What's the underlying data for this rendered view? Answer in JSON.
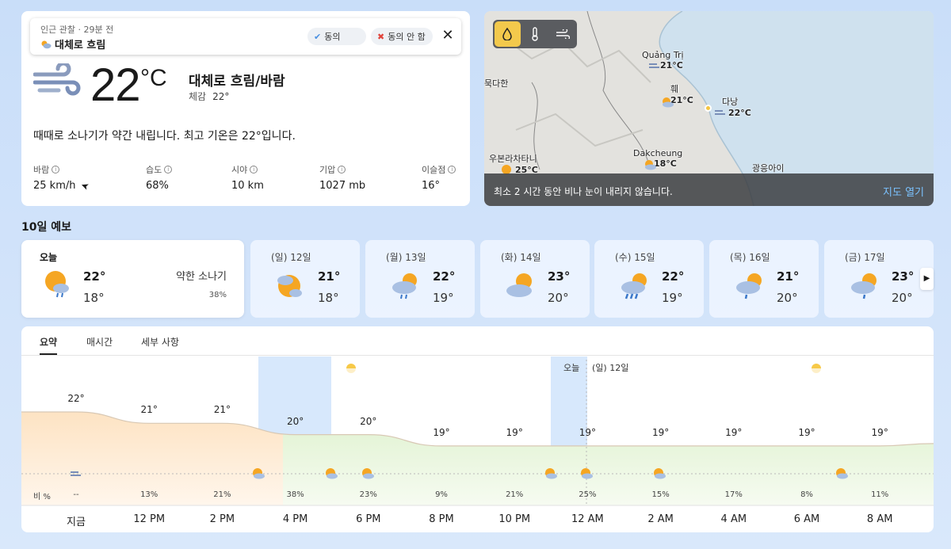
{
  "current": {
    "observation": {
      "header": "인근 관찰 · 29분 전",
      "condition": "대체로 흐림",
      "agree_label": "동의",
      "disagree_label": "동의 안 함"
    },
    "temperature": "22",
    "unit": "°C",
    "condition_title": "대체로 흐림/바람",
    "feels_label": "체감",
    "feels_value": "22°",
    "summary": "때때로 소나기가 약간 내립니다. 최고 기온은 22°입니다.",
    "stats": [
      {
        "label": "바람",
        "value": "25 km/h"
      },
      {
        "label": "습도",
        "value": "68%"
      },
      {
        "label": "시야",
        "value": "10 km"
      },
      {
        "label": "기압",
        "value": "1027 mb"
      },
      {
        "label": "이슬점",
        "value": "16°"
      }
    ]
  },
  "map": {
    "message": "최소 2 시간 동안 비나 눈이 내리지 않습니다.",
    "open_label": "지도 열기",
    "layers": [
      "precipitation-icon",
      "thermometer-icon",
      "wind-icon"
    ],
    "labels": [
      {
        "name": "Quảng Trị",
        "temp": "21°C"
      },
      {
        "name": "훼",
        "temp": "21°C"
      },
      {
        "name": "다낭",
        "temp": "22°C"
      },
      {
        "name": "Dakcheung",
        "temp": "18°C"
      },
      {
        "name": "우본라차타니",
        "temp": "25°C"
      },
      {
        "name": "묵다한",
        "temp": ""
      },
      {
        "name": "광응아이",
        "temp": ""
      }
    ]
  },
  "forecast": {
    "title": "10일 예보",
    "days": [
      {
        "name": "오늘",
        "hi": "22°",
        "lo": "18°",
        "desc": "약한 소나기",
        "precip": "38%",
        "icon": "sun-cloud-rain-icon"
      },
      {
        "name": "(일) 12일",
        "hi": "21°",
        "lo": "18°",
        "icon": "sun-cloud-icon"
      },
      {
        "name": "(월) 13일",
        "hi": "22°",
        "lo": "19°",
        "icon": "sun-cloud-rain-icon"
      },
      {
        "name": "(화) 14일",
        "hi": "23°",
        "lo": "20°",
        "icon": "partly-cloudy-icon"
      },
      {
        "name": "(수) 15일",
        "hi": "22°",
        "lo": "19°",
        "icon": "sun-cloud-heavy-rain-icon"
      },
      {
        "name": "(목) 16일",
        "hi": "21°",
        "lo": "20°",
        "icon": "sun-cloud-rain-icon"
      },
      {
        "name": "(금) 17일",
        "hi": "23°",
        "lo": "20°",
        "icon": "sun-cloud-rain-icon"
      }
    ]
  },
  "chart": {
    "tabs": [
      "요약",
      "매시간",
      "세부 사항"
    ],
    "precip_label": "비 %",
    "today_marker": "오늘",
    "next_day_marker": "(일) 12일"
  },
  "chart_data": {
    "type": "area",
    "x": [
      "지금",
      "",
      "12 PM",
      "",
      "2 PM",
      "",
      "4 PM",
      "",
      "6 PM",
      "",
      "8 PM",
      "",
      "10 PM",
      "",
      "12 AM",
      "",
      "2 AM",
      "",
      "4 AM",
      "",
      "6 AM",
      "",
      "8 AM"
    ],
    "temperature": [
      22,
      21,
      21,
      20,
      20,
      19,
      19,
      19,
      19,
      19,
      19,
      19
    ],
    "temperature_labels": [
      "22°",
      "21°",
      "21°",
      "20°",
      "20°",
      "19°",
      "19°",
      "19°",
      "19°",
      "19°",
      "19°",
      "19°"
    ],
    "precipitation": [
      "--",
      "13%",
      "21%",
      "38%",
      "23%",
      "9%",
      "21%",
      "25%",
      "15%",
      "17%",
      "8%",
      "11%"
    ],
    "xlabels": [
      "지금",
      "12 PM",
      "2 PM",
      "4 PM",
      "6 PM",
      "8 PM",
      "10 PM",
      "12 AM",
      "2 AM",
      "4 AM",
      "6 AM",
      "8 AM"
    ]
  }
}
